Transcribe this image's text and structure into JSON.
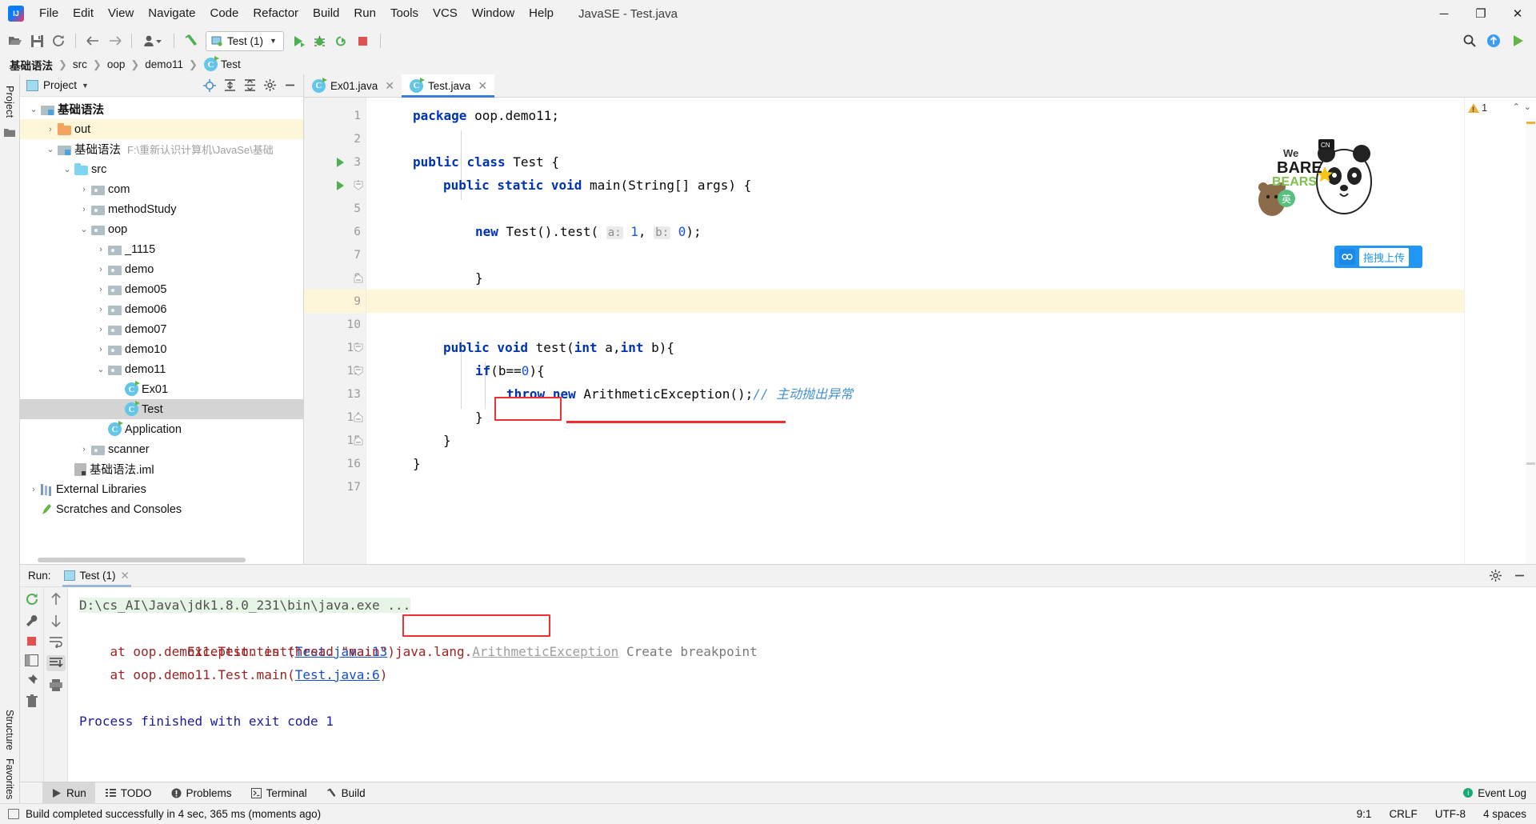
{
  "window": {
    "title": "JavaSE - Test.java",
    "minimize": "─",
    "maximize": "❐",
    "close": "✕"
  },
  "menu": [
    {
      "label": "File"
    },
    {
      "label": "Edit"
    },
    {
      "label": "View"
    },
    {
      "label": "Navigate"
    },
    {
      "label": "Code"
    },
    {
      "label": "Refactor"
    },
    {
      "label": "Build"
    },
    {
      "label": "Run"
    },
    {
      "label": "Tools"
    },
    {
      "label": "VCS"
    },
    {
      "label": "Window"
    },
    {
      "label": "Help"
    }
  ],
  "toolbar": {
    "open_icon": "folder-open-icon",
    "save_icon": "save-icon",
    "sync_icon": "refresh-icon",
    "back_icon": "back-arrow-icon",
    "forward_icon": "forward-arrow-icon",
    "profile_icon": "user-dropdown-icon",
    "build_icon": "hammer-icon",
    "run_config": "Test (1)",
    "run_icon": "run-icon",
    "debug_icon": "debug-icon",
    "coverage_icon": "run-with-coverage-icon",
    "stop_icon": "stop-icon",
    "search_icon": "search-everywhere-icon",
    "update_icon": "update-project-icon",
    "play_icon": "play-icon"
  },
  "breadcrumbs": [
    {
      "label": "基础语法",
      "bold": true
    },
    {
      "label": "src",
      "bold": false
    },
    {
      "label": "oop",
      "bold": false
    },
    {
      "label": "demo11",
      "bold": false
    },
    {
      "label": "Test",
      "bold": false
    }
  ],
  "left_rail": {
    "project_label": "Project"
  },
  "project_panel": {
    "title": "Project",
    "dropdown_icon": "chevron-down-icon",
    "locate_icon": "target-icon",
    "expand_icon": "expand-all-icon",
    "collapse_icon": "collapse-all-icon",
    "settings_icon": "gear-icon",
    "hide_icon": "minimize-icon",
    "tree": [
      {
        "label": "基础语法",
        "indent": 0,
        "arrow": "down",
        "icon": "module-folder",
        "bold": true,
        "state": "none",
        "path": ""
      },
      {
        "label": "out",
        "indent": 1,
        "arrow": "right",
        "icon": "folder-orange",
        "bold": false,
        "state": "hl",
        "path": ""
      },
      {
        "label": "基础语法",
        "indent": 1,
        "arrow": "down",
        "icon": "module-folder",
        "bold": false,
        "state": "none",
        "path": "F:\\重新认识计算机\\JavaSe\\基础"
      },
      {
        "label": "src",
        "indent": 2,
        "arrow": "down",
        "icon": "folder-blue",
        "bold": false,
        "state": "none",
        "path": ""
      },
      {
        "label": "com",
        "indent": 3,
        "arrow": "right",
        "icon": "folder-pkg",
        "bold": false,
        "state": "none",
        "path": ""
      },
      {
        "label": "methodStudy",
        "indent": 3,
        "arrow": "right",
        "icon": "folder-pkg",
        "bold": false,
        "state": "none",
        "path": ""
      },
      {
        "label": "oop",
        "indent": 3,
        "arrow": "down",
        "icon": "folder-pkg",
        "bold": false,
        "state": "none",
        "path": ""
      },
      {
        "label": "_1115",
        "indent": 4,
        "arrow": "right",
        "icon": "folder-pkg",
        "bold": false,
        "state": "none",
        "path": ""
      },
      {
        "label": "demo",
        "indent": 4,
        "arrow": "right",
        "icon": "folder-pkg",
        "bold": false,
        "state": "none",
        "path": ""
      },
      {
        "label": "demo05",
        "indent": 4,
        "arrow": "right",
        "icon": "folder-pkg",
        "bold": false,
        "state": "none",
        "path": ""
      },
      {
        "label": "demo06",
        "indent": 4,
        "arrow": "right",
        "icon": "folder-pkg",
        "bold": false,
        "state": "none",
        "path": ""
      },
      {
        "label": "demo07",
        "indent": 4,
        "arrow": "right",
        "icon": "folder-pkg",
        "bold": false,
        "state": "none",
        "path": ""
      },
      {
        "label": "demo10",
        "indent": 4,
        "arrow": "right",
        "icon": "folder-pkg",
        "bold": false,
        "state": "none",
        "path": ""
      },
      {
        "label": "demo11",
        "indent": 4,
        "arrow": "down",
        "icon": "folder-pkg",
        "bold": false,
        "state": "none",
        "path": ""
      },
      {
        "label": "Ex01",
        "indent": 5,
        "arrow": "none",
        "icon": "java-class",
        "bold": false,
        "state": "none",
        "path": ""
      },
      {
        "label": "Test",
        "indent": 5,
        "arrow": "none",
        "icon": "java-class",
        "bold": false,
        "state": "sel",
        "path": ""
      },
      {
        "label": "Application",
        "indent": 4,
        "arrow": "none",
        "icon": "java-class",
        "bold": false,
        "state": "none",
        "path": ""
      },
      {
        "label": "scanner",
        "indent": 3,
        "arrow": "right",
        "icon": "folder-pkg",
        "bold": false,
        "state": "none",
        "path": ""
      },
      {
        "label": "基础语法.iml",
        "indent": 2,
        "arrow": "none",
        "icon": "iml-file",
        "bold": false,
        "state": "none",
        "path": ""
      },
      {
        "label": "External Libraries",
        "indent": 0,
        "arrow": "right",
        "icon": "library",
        "bold": false,
        "state": "none",
        "path": ""
      },
      {
        "label": "Scratches and Consoles",
        "indent": 0,
        "arrow": "none",
        "icon": "scratch",
        "bold": false,
        "state": "none",
        "path": ""
      }
    ]
  },
  "editor": {
    "tabs": [
      {
        "label": "Ex01.java",
        "active": false,
        "close": "✕"
      },
      {
        "label": "Test.java",
        "active": true,
        "close": "✕"
      }
    ],
    "lines": [
      {
        "n": "1",
        "run": false,
        "fold": "",
        "hl": false
      },
      {
        "n": "2",
        "run": false,
        "fold": "",
        "hl": false
      },
      {
        "n": "3",
        "run": true,
        "fold": "",
        "hl": false
      },
      {
        "n": "4",
        "run": true,
        "fold": "open",
        "hl": false
      },
      {
        "n": "5",
        "run": false,
        "fold": "",
        "hl": false
      },
      {
        "n": "6",
        "run": false,
        "fold": "",
        "hl": false
      },
      {
        "n": "7",
        "run": false,
        "fold": "",
        "hl": false
      },
      {
        "n": "8",
        "run": false,
        "fold": "close",
        "hl": false
      },
      {
        "n": "9",
        "run": false,
        "fold": "",
        "hl": true
      },
      {
        "n": "10",
        "run": false,
        "fold": "",
        "hl": false
      },
      {
        "n": "11",
        "run": false,
        "fold": "open",
        "hl": false
      },
      {
        "n": "12",
        "run": false,
        "fold": "open",
        "hl": false
      },
      {
        "n": "13",
        "run": false,
        "fold": "",
        "hl": false
      },
      {
        "n": "14",
        "run": false,
        "fold": "close",
        "hl": false
      },
      {
        "n": "15",
        "run": false,
        "fold": "close",
        "hl": false
      },
      {
        "n": "16",
        "run": false,
        "fold": "",
        "hl": false
      },
      {
        "n": "17",
        "run": false,
        "fold": "",
        "hl": false
      }
    ],
    "code": {
      "l1_kw": "package",
      "l1_rest": " oop.demo11;",
      "l3_kw1": "public",
      "l3_kw2": "class",
      "l3_name": " Test {",
      "l4_kw": "public static void",
      "l4_rest": " main(String[] args) {",
      "l6_kw": "new",
      "l6_a": " Test().test(",
      "l6_hint_a": "a:",
      "l6_n1": "1",
      "l6_comma": ",",
      "l6_hint_b": "b:",
      "l6_n2": "0",
      "l6_end": ");",
      "l8": "}",
      "l11_kw": "public void",
      "l11_mid": " test(",
      "l11_kw2": "int",
      "l11_a": " a,",
      "l11_kw3": "int",
      "l11_b": " b){",
      "l12_kw": "if",
      "l12_a": "(b==",
      "l12_n": "0",
      "l12_b": "){",
      "l13_kw": "throw",
      "l13_new": "new",
      "l13_rest": " ArithmeticException();",
      "l13_comment": "// 主动抛出异常",
      "l14": "}",
      "l15": "}",
      "l16": "}"
    },
    "inspection": {
      "warning_count": "1",
      "up_icon": "chevron-up-icon",
      "down_icon": "chevron-down-icon",
      "warn_icon": "warning-triangle-icon"
    },
    "sticker": {
      "brand_top": "CN",
      "text_we": "We",
      "text_bare": "BARE",
      "text_bears": "BEARS",
      "badge": "英"
    },
    "upload_widget": {
      "icon": "upload-icon",
      "label": "拖拽上传"
    }
  },
  "run_panel": {
    "label": "Run:",
    "tab": "Test (1)",
    "tab_close": "✕",
    "settings_icon": "gear-icon",
    "hide_icon": "minimize-icon",
    "rail_icons": [
      "rerun-icon",
      "wrench-icon",
      "stop-icon",
      "layout-icon",
      "pin-icon",
      "trash-icon"
    ],
    "rail2_icons": [
      "up-arrow-icon",
      "down-arrow-icon",
      "soft-wrap-icon",
      "scroll-to-end-icon",
      "print-icon"
    ],
    "console": {
      "cmd": "D:\\cs_AI\\Java\\jdk1.8.0_231\\bin\\java.exe ...",
      "exc_prefix": "Exception in thread \"main\" java.lang.",
      "exc_name": "ArithmeticException",
      "create_breakpoint": "Create breakpoint",
      "trace1_pre": "    at oop.demo11.Test.test(",
      "trace1_link": "Test.java:13",
      "trace1_post": ")",
      "trace2_pre": "    at oop.demo11.Test.main(",
      "trace2_link": "Test.java:6",
      "trace2_post": ")",
      "finish": "Process finished with exit code 1"
    }
  },
  "side_rail": {
    "structure": "Structure",
    "favorites": "Favorites"
  },
  "tool_tabs": [
    {
      "label": "Run",
      "icon": "run-icon",
      "active": true
    },
    {
      "label": "TODO",
      "icon": "todo-icon",
      "active": false
    },
    {
      "label": "Problems",
      "icon": "problems-icon",
      "active": false
    },
    {
      "label": "Terminal",
      "icon": "terminal-icon",
      "active": false
    },
    {
      "label": "Build",
      "icon": "build-hammer-icon",
      "active": false
    }
  ],
  "tool_tabs_right": {
    "event_log": "Event Log",
    "dot_icon": "green-dot-icon"
  },
  "statusbar": {
    "message": "Build completed successfully in 4 sec, 365 ms (moments ago)",
    "icon": "build-status-icon",
    "caret": "9:1",
    "line_sep": "CRLF",
    "encoding": "UTF-8",
    "indent": "4 spaces"
  },
  "colors": {
    "accent": "#3b7dd8",
    "keyword": "#0033b3",
    "number": "#1750eb",
    "comment": "#3f8fd1",
    "error": "#9b2323",
    "highlight_box": "#f03030",
    "selection": "#d4d4d4",
    "current_line": "#fdf6d8"
  }
}
